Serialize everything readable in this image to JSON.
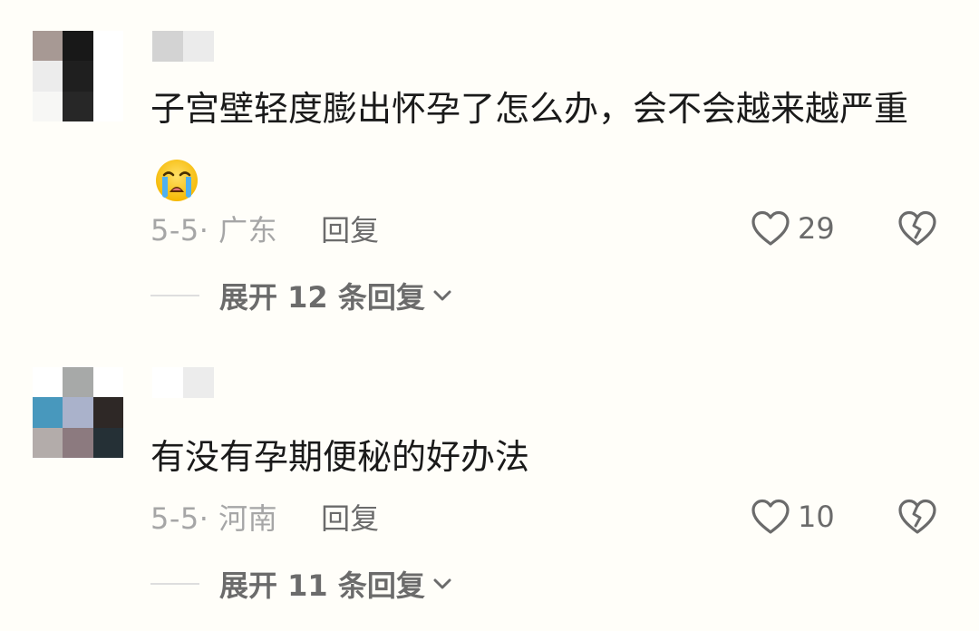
{
  "comments": [
    {
      "text": "子宫壁轻度膨出怀孕了怎么办，会不会越来越严重",
      "emoji": "loudly-crying-face",
      "date_location": "5-5· 广东",
      "reply_label": "回复",
      "likes": "29",
      "expand_label": "展开 12 条回复",
      "avatar_icon": "blurred-avatar",
      "colors": {
        "avatar": [
          "#a79994",
          "#181818",
          "#ffffff",
          "#ececec",
          "#1f1f1f",
          "#ffffff",
          "#f7f7f5",
          "#272727",
          "#ffffff"
        ],
        "username": [
          "#d3d3d3",
          "#ebebeb"
        ]
      }
    },
    {
      "text": "有没有孕期便秘的好办法",
      "date_location": "5-5· 河南",
      "reply_label": "回复",
      "likes": "10",
      "expand_label": "展开 11 条回复",
      "avatar_icon": "blurred-avatar",
      "colors": {
        "avatar": [
          "#ffffff",
          "#a7a9a8",
          "#ffffff",
          "#4898bd",
          "#aab2cb",
          "#2e2826",
          "#b3acaa",
          "#8c7a7f",
          "#253036"
        ],
        "username": [
          "#ffffff",
          "#ececec"
        ]
      }
    }
  ],
  "icons": {
    "like": "heart-outline-icon",
    "dislike": "broken-heart-icon",
    "expand": "chevron-down-icon"
  },
  "theme": {
    "background": "#fffef9",
    "text": "#1a1a1a",
    "meta": "#a6a6a6",
    "secondary": "#6b6b6b"
  }
}
